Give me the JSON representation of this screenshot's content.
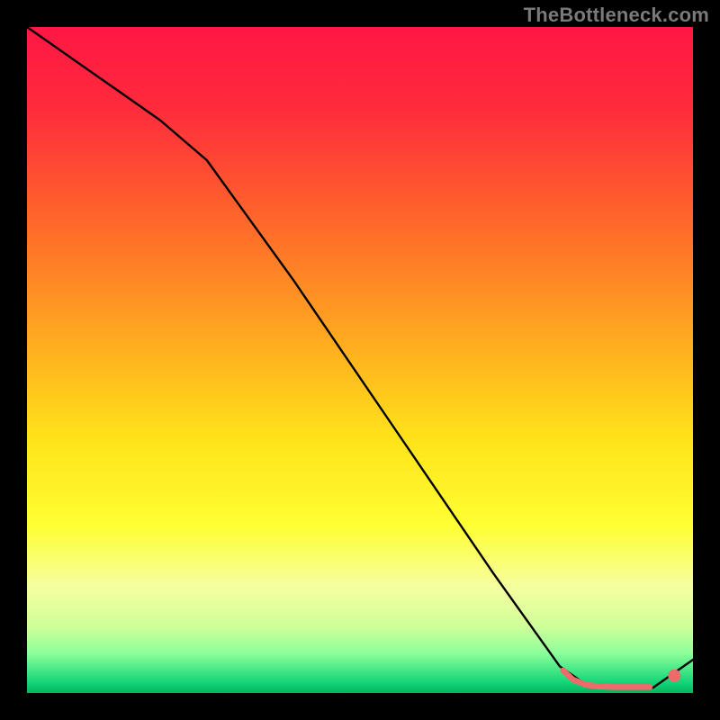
{
  "watermark": "TheBottleneck.com",
  "chart_data": {
    "type": "line",
    "title": "",
    "xlabel": "",
    "ylabel": "",
    "xlim": [
      0,
      100
    ],
    "ylim": [
      0,
      100
    ],
    "grid": false,
    "legend": false,
    "gradient_stops": [
      {
        "pos": 0.0,
        "color": "#ff1744"
      },
      {
        "pos": 0.12,
        "color": "#ff2a3c"
      },
      {
        "pos": 0.3,
        "color": "#ff6a2a"
      },
      {
        "pos": 0.48,
        "color": "#ffae1f"
      },
      {
        "pos": 0.62,
        "color": "#ffe31a"
      },
      {
        "pos": 0.75,
        "color": "#ffff33"
      },
      {
        "pos": 0.84,
        "color": "#f6ffa0"
      },
      {
        "pos": 0.9,
        "color": "#cfff99"
      },
      {
        "pos": 0.94,
        "color": "#8dff9a"
      },
      {
        "pos": 0.965,
        "color": "#47e887"
      },
      {
        "pos": 0.985,
        "color": "#12d477"
      },
      {
        "pos": 1.0,
        "color": "#05b35e"
      }
    ],
    "series": [
      {
        "name": "curve",
        "color": "#000000",
        "width": 2.4,
        "x": [
          0,
          10,
          20,
          27,
          40,
          55,
          70,
          80,
          84,
          88,
          92,
          94,
          100
        ],
        "y": [
          100,
          93,
          86,
          80,
          62,
          40,
          18,
          4,
          1.2,
          0.8,
          0.8,
          0.8,
          5.0
        ]
      },
      {
        "name": "flat-highlight",
        "color": "#ef6a6a",
        "width": 6.5,
        "cap": "round",
        "x": [
          80.5,
          82,
          84,
          86,
          88,
          90,
          92,
          93.5
        ],
        "y": [
          3.4,
          2.0,
          1.2,
          1.0,
          0.9,
          0.9,
          0.9,
          0.9
        ]
      },
      {
        "name": "end-dot",
        "type": "scatter",
        "color": "#ef6a6a",
        "size": 14,
        "x": [
          97.2
        ],
        "y": [
          2.6
        ]
      }
    ]
  }
}
